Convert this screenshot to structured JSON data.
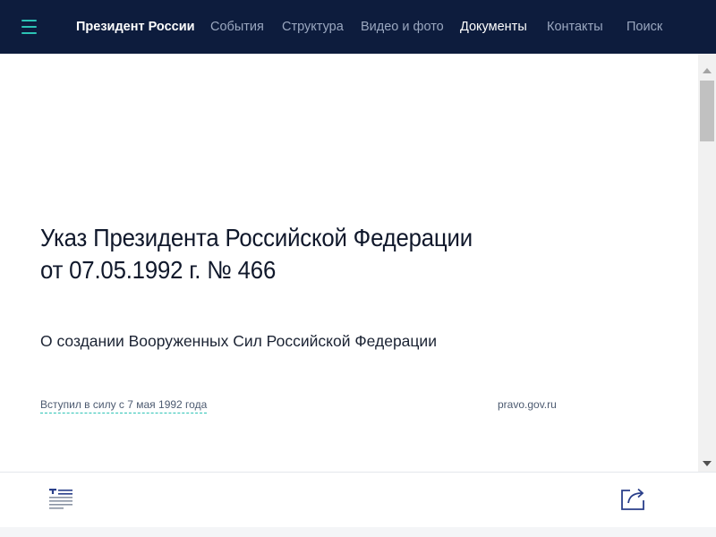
{
  "nav": {
    "menu_icon": "hamburger-menu-icon",
    "brand": "Президент России",
    "links": {
      "events": "События",
      "structure": "Структура",
      "media": "Видео и фото",
      "documents": "Документы",
      "contacts": "Контакты",
      "search": "Поиск"
    },
    "active": "documents"
  },
  "document": {
    "title_line1": "Указ Президента Российской Федерации",
    "title_line2": "от 07.05.1992 г. № 466",
    "subject": "О создании Вооруженных Сил Российской Федерации",
    "status": "Вступил в силу с 7 мая 1992 года",
    "source": "pravo.gov.ru"
  },
  "bottom_bar": {
    "left_icon": "text-view-icon",
    "right_icon": "share-icon"
  },
  "colors": {
    "nav_background": "#0d1c3d",
    "accent": "#2cc3b5",
    "nav_link": "#9aa7bf",
    "title_text": "#10182b"
  }
}
